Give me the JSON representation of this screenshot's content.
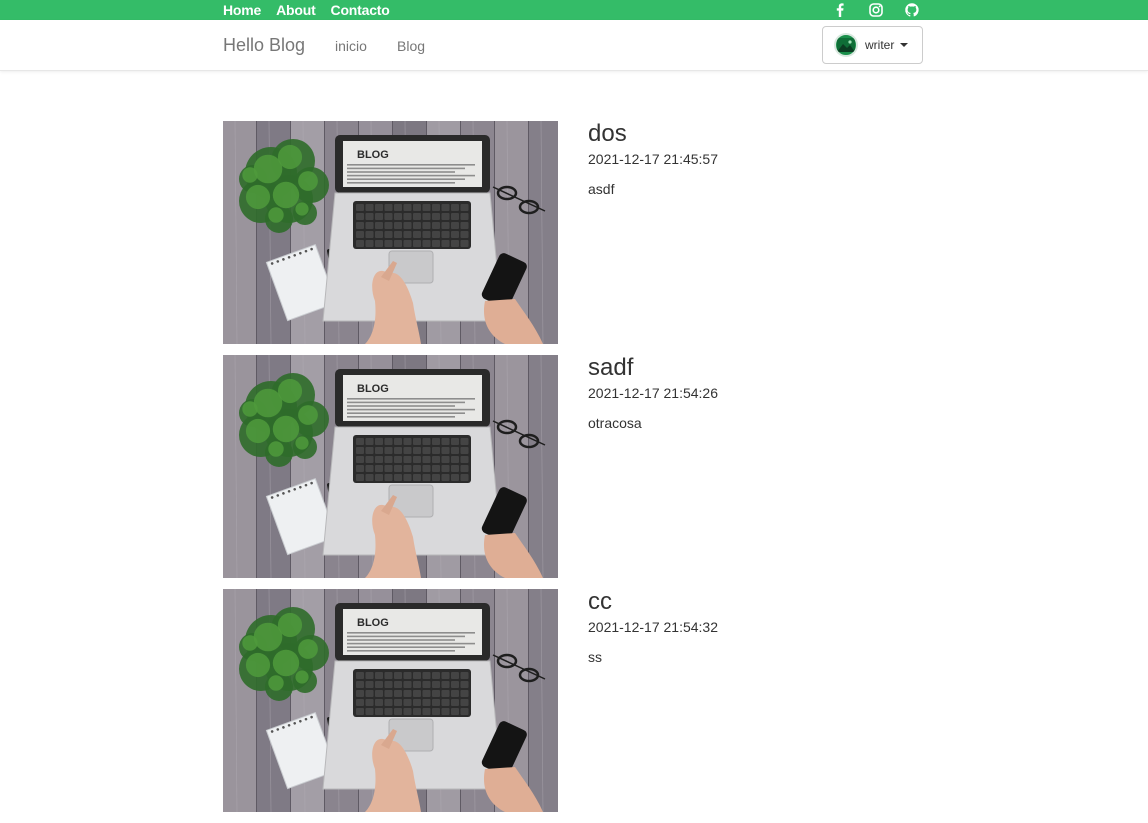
{
  "topbar": {
    "links": [
      "Home",
      "About",
      "Contacto"
    ],
    "social": [
      "facebook-icon",
      "instagram-icon",
      "github-icon"
    ],
    "color": "#34bc68"
  },
  "navbar": {
    "brand": "Hello Blog",
    "links": [
      "inicio",
      "Blog"
    ],
    "user": {
      "name": "writer",
      "avatar_icon": "avatar-icon"
    }
  },
  "posts": [
    {
      "title": "dos",
      "date": "2021-12-17 21:45:57",
      "body": "asdf",
      "image_icon": "blog-laptop-image"
    },
    {
      "title": "sadf",
      "date": "2021-12-17 21:54:26",
      "body": "otracosa",
      "image_icon": "blog-laptop-image"
    },
    {
      "title": "cc",
      "date": "2021-12-17 21:54:32",
      "body": "ss",
      "image_icon": "blog-laptop-image"
    }
  ],
  "image_text": "BLOG"
}
